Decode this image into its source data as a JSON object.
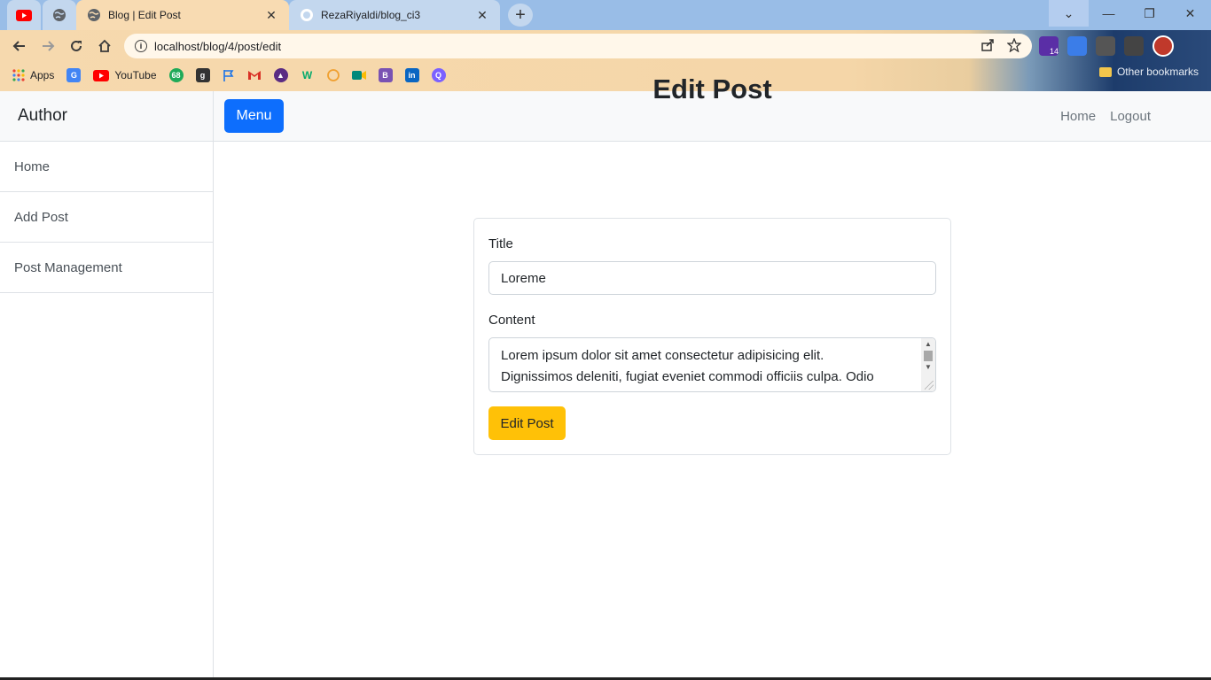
{
  "browser": {
    "pinned_tabs": [
      {
        "icon": "youtube-icon"
      },
      {
        "icon": "globe-icon"
      }
    ],
    "tabs": [
      {
        "title": "Blog | Edit Post",
        "icon": "globe-icon",
        "active": true
      },
      {
        "title": "RezaRiyaldi/blog_ci3",
        "icon": "github-icon",
        "active": false
      }
    ],
    "close_glyph": "✕",
    "new_tab_glyph": "+",
    "window_controls": {
      "chevron": "⌄",
      "minimize": "—",
      "restore": "❐",
      "close": "✕"
    },
    "url": "localhost/blog/4/post/edit",
    "bookmarks": [
      {
        "label": "Apps",
        "icon": "apps-grid-icon",
        "color": "#ea4335"
      },
      {
        "label": "",
        "icon": "google-translate-icon",
        "color": "#4285f4"
      },
      {
        "label": "YouTube",
        "icon": "youtube-icon",
        "color": "#ff0000"
      },
      {
        "label": "",
        "icon": "bookmark-68-icon",
        "color": "#1faa59"
      },
      {
        "label": "",
        "icon": "bookmark-g-icon",
        "color": "#333333"
      },
      {
        "label": "",
        "icon": "flag-icon",
        "color": "#1a73e8"
      },
      {
        "label": "",
        "icon": "gmail-icon",
        "color": "#d93025"
      },
      {
        "label": "",
        "icon": "bookmark-hat-icon",
        "color": "#5b2c83"
      },
      {
        "label": "",
        "icon": "w3schools-icon",
        "color": "#04aa6d"
      },
      {
        "label": "",
        "icon": "github-icon",
        "color": "#f0a030"
      },
      {
        "label": "",
        "icon": "google-meet-icon",
        "color": "#00897b"
      },
      {
        "label": "",
        "icon": "bootstrap-icon",
        "color": "#7952b3"
      },
      {
        "label": "",
        "icon": "linkedin-icon",
        "color": "#0a66c2"
      },
      {
        "label": "",
        "icon": "bookmark-q-icon",
        "color": "#7b61ff"
      }
    ],
    "other_bookmarks": "Other bookmarks",
    "extension_badge": "14"
  },
  "sidebar": {
    "brand": "Author",
    "items": [
      {
        "label": "Home"
      },
      {
        "label": "Add Post"
      },
      {
        "label": "Post Management"
      }
    ]
  },
  "topnav": {
    "menu_button": "Menu",
    "links": [
      {
        "label": "Home"
      },
      {
        "label": "Logout"
      }
    ]
  },
  "form": {
    "heading": "Edit Post",
    "title_label": "Title",
    "title_value": "Loreme",
    "content_label": "Content",
    "content_lines": [
      "Lorem ipsum dolor sit amet consectetur adipisicing elit.",
      "Dignissimos deleniti, fugiat eveniet commodi officiis culpa. Odio"
    ],
    "submit_label": "Edit Post"
  },
  "colors": {
    "primary": "#0d6efd",
    "warning": "#ffc107",
    "sidebar_bg": "#f8f9fa"
  }
}
